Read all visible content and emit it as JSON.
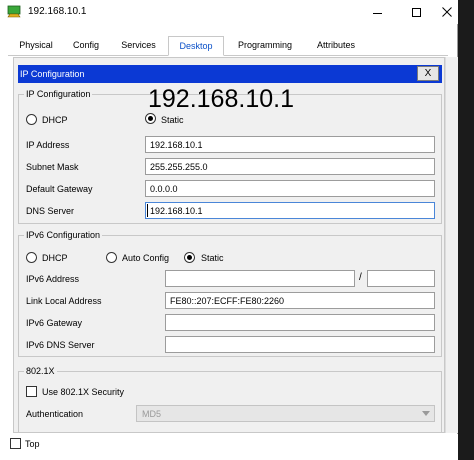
{
  "window": {
    "title": "192.168.10.1",
    "icon": "packet-tracer-pc-icon",
    "controls": {
      "minimize": "minimize-icon",
      "maximize": "maximize-icon",
      "close": "close-icon"
    }
  },
  "tabs": [
    {
      "label": "Physical",
      "active": false
    },
    {
      "label": "Config",
      "active": false
    },
    {
      "label": "Services",
      "active": false
    },
    {
      "label": "Desktop",
      "active": true
    },
    {
      "label": "Programming",
      "active": false
    },
    {
      "label": "Attributes",
      "active": false
    }
  ],
  "ip_config_window": {
    "title": "IP Configuration",
    "close_label": "X",
    "overlay_text": "192.168.10.1",
    "ipv4": {
      "group_label": "IP Configuration",
      "mode_dhcp": "DHCP",
      "mode_static": "Static",
      "selected_mode": "Static",
      "fields": {
        "ip_address": {
          "label": "IP Address",
          "value": "192.168.10.1"
        },
        "subnet_mask": {
          "label": "Subnet Mask",
          "value": "255.255.255.0"
        },
        "default_gateway": {
          "label": "Default Gateway",
          "value": "0.0.0.0"
        },
        "dns_server": {
          "label": "DNS Server",
          "value": "192.168.10.1"
        }
      }
    },
    "ipv6": {
      "group_label": "IPv6 Configuration",
      "mode_dhcp": "DHCP",
      "mode_auto": "Auto Config",
      "mode_static": "Static",
      "selected_mode": "Static",
      "fields": {
        "ipv6_address": {
          "label": "IPv6 Address",
          "value": "",
          "prefix_separator": "/",
          "prefix_value": ""
        },
        "link_local": {
          "label": "Link Local Address",
          "value": "FE80::207:ECFF:FE80:2260"
        },
        "ipv6_gateway": {
          "label": "IPv6 Gateway",
          "value": ""
        },
        "ipv6_dns": {
          "label": "IPv6 DNS Server",
          "value": ""
        }
      }
    },
    "dot1x": {
      "group_label": "802.1X",
      "use_security_label": "Use 802.1X Security",
      "use_security_checked": false,
      "authentication_label": "Authentication",
      "authentication_value": "MD5"
    }
  },
  "footer": {
    "top_label": "Top",
    "top_checked": false
  }
}
